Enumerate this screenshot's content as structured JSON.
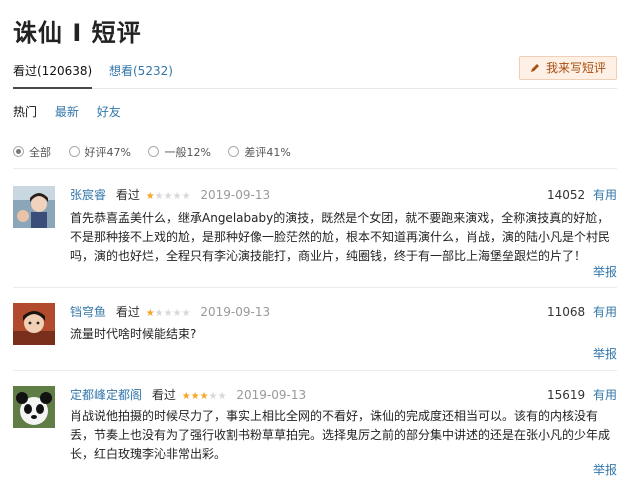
{
  "page": {
    "title": "诛仙 I 短评"
  },
  "tabs": {
    "watched": "看过(120638)",
    "want": "想看(5232)",
    "write": "我来写短评"
  },
  "sort": {
    "hot": "热门",
    "latest": "最新",
    "friends": "好友"
  },
  "filters": [
    {
      "label": "全部",
      "checked": true
    },
    {
      "label": "好评47%",
      "checked": false
    },
    {
      "label": "一般12%",
      "checked": false
    },
    {
      "label": "差评41%",
      "checked": false
    }
  ],
  "reviews": [
    {
      "user": "张宸睿",
      "status": "看过",
      "rating": 1,
      "date": "2019-09-13",
      "votes": "14052",
      "useful": "有用",
      "report": "举报",
      "text": "首先恭喜孟美什么，继承Angelababy的演技，既然是个女团，就不要跑来演戏，全称演技真的好尬，不是那种接不上戏的尬，是那种好像一脸茫然的尬，根本不知道再演什么，肖战，演的陆小凡是个村民吗，演的也好烂，全程只有李沁演技能打，商业片，纯圈钱，终于有一部比上海堡垒跟烂的片了！"
    },
    {
      "user": "铛穹鱼",
      "status": "看过",
      "rating": 1,
      "date": "2019-09-13",
      "votes": "11068",
      "useful": "有用",
      "report": "举报",
      "text": "流量时代啥时候能结束?"
    },
    {
      "user": "定都峰定都阁",
      "status": "看过",
      "rating": 3,
      "date": "2019-09-13",
      "votes": "15619",
      "useful": "有用",
      "report": "举报",
      "text": "肖战说他拍摄的时候尽力了，事实上相比全网的不看好，诛仙的完成度还相当可以。该有的内核没有丢，节奏上也没有为了强行收割书粉草草拍完。选择鬼厉之前的部分集中讲述的还是在张小凡的少年成长，红白玫瑰李沁非常出彩。"
    }
  ],
  "colors": {
    "link": "#3377aa",
    "star": "#f5a623",
    "accent_bg": "#fff0e6"
  }
}
